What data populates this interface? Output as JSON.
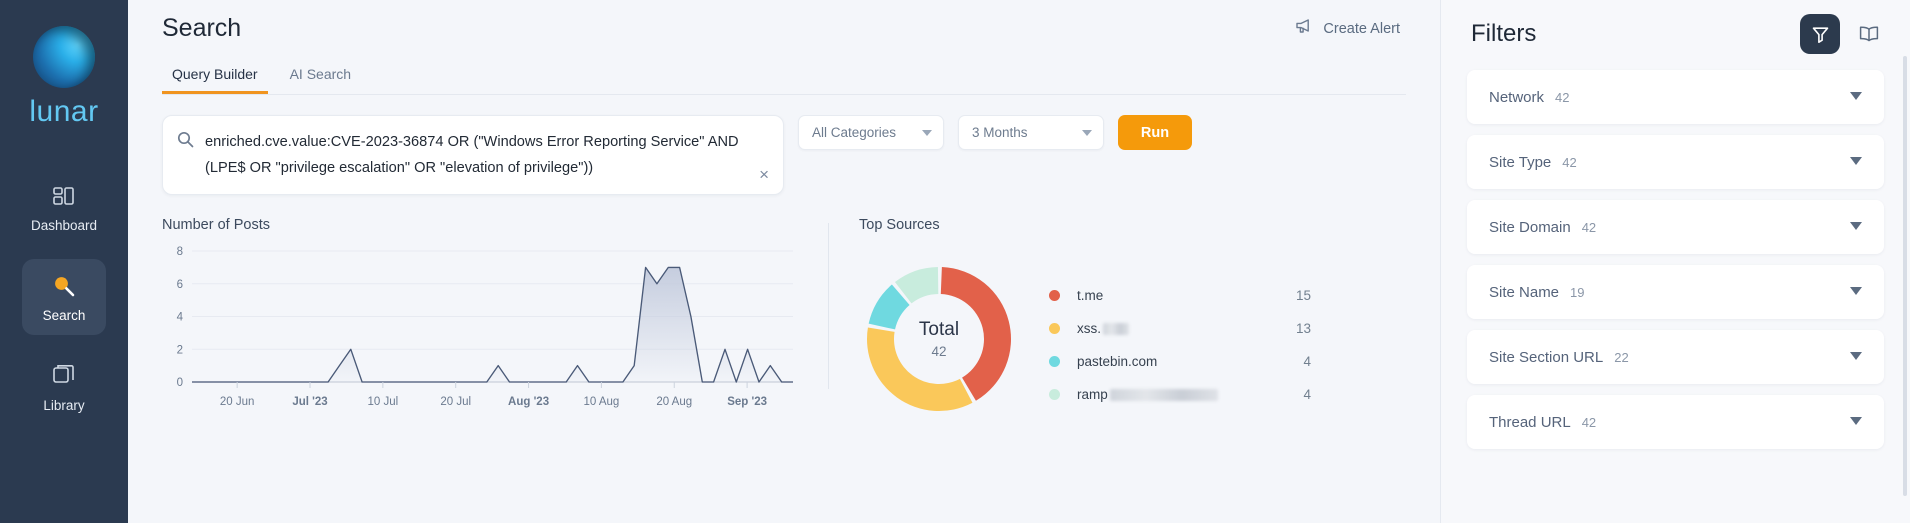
{
  "sidebar": {
    "brand": "lunar",
    "items": [
      {
        "label": "Dashboard",
        "icon": "dashboard-icon",
        "active": false
      },
      {
        "label": "Search",
        "icon": "search-icon",
        "active": true
      },
      {
        "label": "Library",
        "icon": "library-icon",
        "active": false
      }
    ]
  },
  "header": {
    "title": "Search",
    "create_alert": "Create Alert",
    "create_alert_icon": "megaphone-icon"
  },
  "tabs": [
    {
      "label": "Query Builder",
      "active": true
    },
    {
      "label": "AI Search",
      "active": false
    }
  ],
  "query": {
    "search_icon": "search-icon",
    "value": "enriched.cve.value:CVE-2023-36874 OR (\"Windows Error Reporting Service\" AND (LPE$ OR \"privilege escalation\" OR \"elevation of privilege\"))",
    "clear_icon": "close-icon",
    "clear_label": "×",
    "category_select": "All Categories",
    "period_select": "3 Months",
    "run_label": "Run",
    "accent_color": "#f59a0b"
  },
  "chart_data": [
    {
      "type": "area",
      "title": "Number of Posts",
      "xlabel": "",
      "ylabel": "",
      "ylim": [
        0,
        8
      ],
      "yticks": [
        0,
        2,
        4,
        6,
        8
      ],
      "xticks": [
        "20 Jun",
        "Jul '23",
        "10 Jul",
        "20 Jul",
        "Aug '23",
        "10 Aug",
        "20 Aug",
        "Sep '23"
      ],
      "grid": true,
      "line_color": "#4a5a78",
      "fill_color": "#c3cbdd",
      "x": [
        "Jun 12",
        "Jun 14",
        "Jun 16",
        "Jun 18",
        "Jun 20",
        "Jun 22",
        "Jun 24",
        "Jun 26",
        "Jun 28",
        "Jun 30",
        "Jul 02",
        "Jul 04",
        "Jul 06",
        "Jul 08",
        "Jul 10",
        "Jul 11",
        "Jul 12",
        "Jul 13",
        "Jul 15",
        "Jul 17",
        "Jul 19",
        "Jul 21",
        "Jul 23",
        "Jul 25",
        "Jul 27",
        "Jul 29",
        "Jul 31",
        "Aug 02",
        "Aug 03",
        "Aug 04",
        "Aug 05",
        "Aug 07",
        "Aug 09",
        "Aug 11",
        "Aug 13",
        "Aug 14",
        "Aug 15",
        "Aug 17",
        "Aug 19",
        "Aug 21",
        "Aug 22",
        "Aug 23",
        "Aug 24",
        "Aug 25",
        "Aug 26",
        "Aug 28",
        "Aug 29",
        "Aug 30",
        "Aug 31",
        "Sep 01",
        "Sep 02",
        "Sep 03",
        "Sep 04",
        "Sep 05"
      ],
      "values": [
        0,
        0,
        0,
        0,
        0,
        0,
        0,
        0,
        0,
        0,
        0,
        0,
        0,
        1,
        2,
        0,
        0,
        0,
        0,
        0,
        0,
        0,
        0,
        0,
        0,
        0,
        0,
        1,
        0,
        0,
        0,
        0,
        0,
        0,
        1,
        0,
        0,
        0,
        0,
        1,
        7,
        6,
        7,
        7,
        4,
        0,
        0,
        2,
        0,
        2,
        0,
        1,
        0,
        0
      ]
    },
    {
      "type": "pie",
      "title": "Top Sources",
      "center_label": "Total",
      "center_value": "42",
      "labels": [
        "t.me",
        "xss.",
        "pastebin.com",
        "ramp"
      ],
      "labels_redacted": [
        false,
        true,
        false,
        true
      ],
      "values": [
        15,
        13,
        4,
        4
      ],
      "colors": [
        "#e2614a",
        "#fac85a",
        "#6fd9e0",
        "#c8ecdd"
      ],
      "legend": "right"
    }
  ],
  "filters": {
    "title": "Filters",
    "filter_icon": "funnel-icon",
    "book_icon": "book-icon",
    "items": [
      {
        "name": "Network",
        "count": "42"
      },
      {
        "name": "Site Type",
        "count": "42"
      },
      {
        "name": "Site Domain",
        "count": "42"
      },
      {
        "name": "Site Name",
        "count": "19"
      },
      {
        "name": "Site Section URL",
        "count": "22"
      },
      {
        "name": "Thread URL",
        "count": "42"
      }
    ]
  }
}
